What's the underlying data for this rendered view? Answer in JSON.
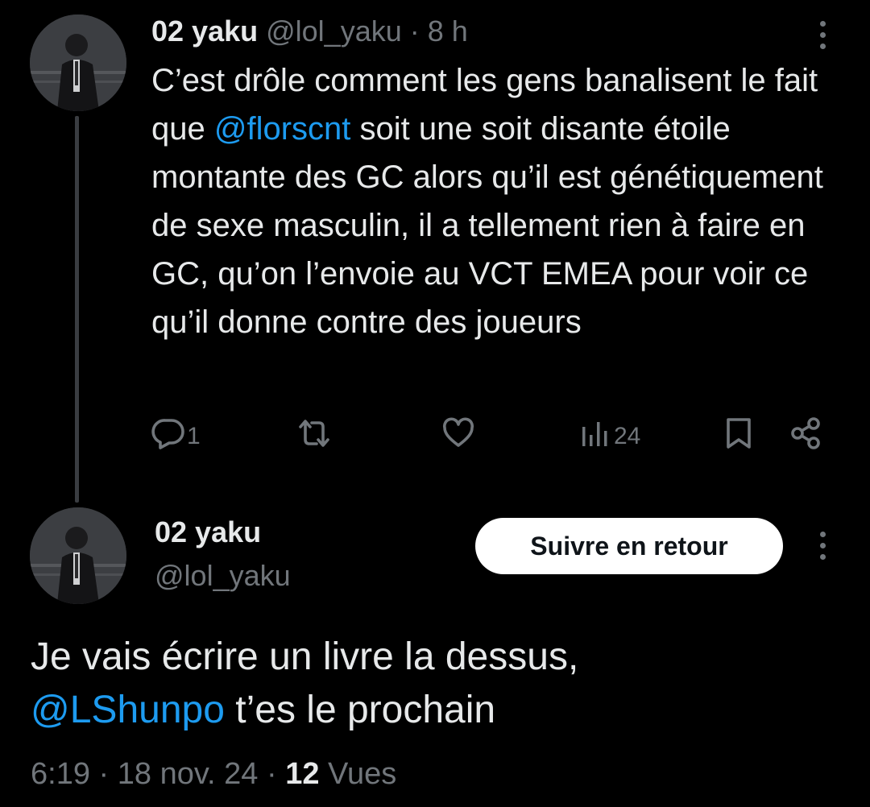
{
  "tweet": {
    "author_name": "02 yaku",
    "author_handle": "@lol_yaku",
    "separator": "·",
    "time_ago": "8 h",
    "text_part1": "C’est drôle comment les gens banalisent le fait que ",
    "mention": "@florscnt",
    "text_part2": " soit une soit disante étoile montante des GC alors qu’il est génétiquement de sexe masculin, il a tellement rien à faire en GC, qu’on l’envoie au VCT EMEA pour voir ce qu’il donne contre des joueurs",
    "reply_count": "1",
    "view_count": "24"
  },
  "reply": {
    "author_name": "02 yaku",
    "author_handle": "@lol_yaku",
    "follow_label": "Suivre en retour",
    "text_line1": "Je vais écrire un livre la dessus,",
    "mention": "@LShunpo",
    "text_line2_rest": " t’es le prochain",
    "time": "6:19",
    "sep1": " · ",
    "date": "18 nov. 24",
    "sep2": " · ",
    "views_count": "12",
    "views_label": " Vues"
  },
  "colors": {
    "background": "#000000",
    "text": "#e7e9ea",
    "muted": "#71767b",
    "mention": "#1d9bf0",
    "button": "#ffffff"
  },
  "icons": [
    "reply-icon",
    "retweet-icon",
    "like-icon",
    "views-icon",
    "bookmark-icon",
    "share-icon",
    "more-icon"
  ]
}
